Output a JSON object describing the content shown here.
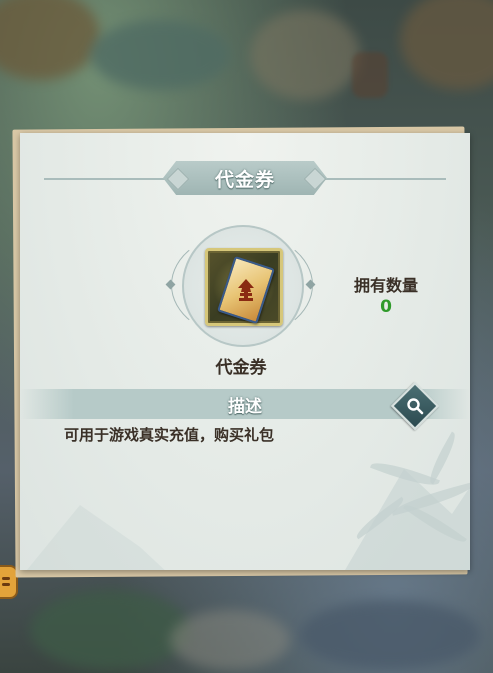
{
  "dialog": {
    "title": "代金券"
  },
  "item": {
    "name": "代金券",
    "icon": "voucher-ticket-icon",
    "owned_label": "拥有数量",
    "owned_count": "0"
  },
  "description": {
    "header": "描述",
    "text": "可用于游戏真实充值，购买礼包"
  },
  "colors": {
    "owned_count": "#2f9a2a",
    "frame_gold": "#d6c77a",
    "banner": "#a9bcbb"
  }
}
